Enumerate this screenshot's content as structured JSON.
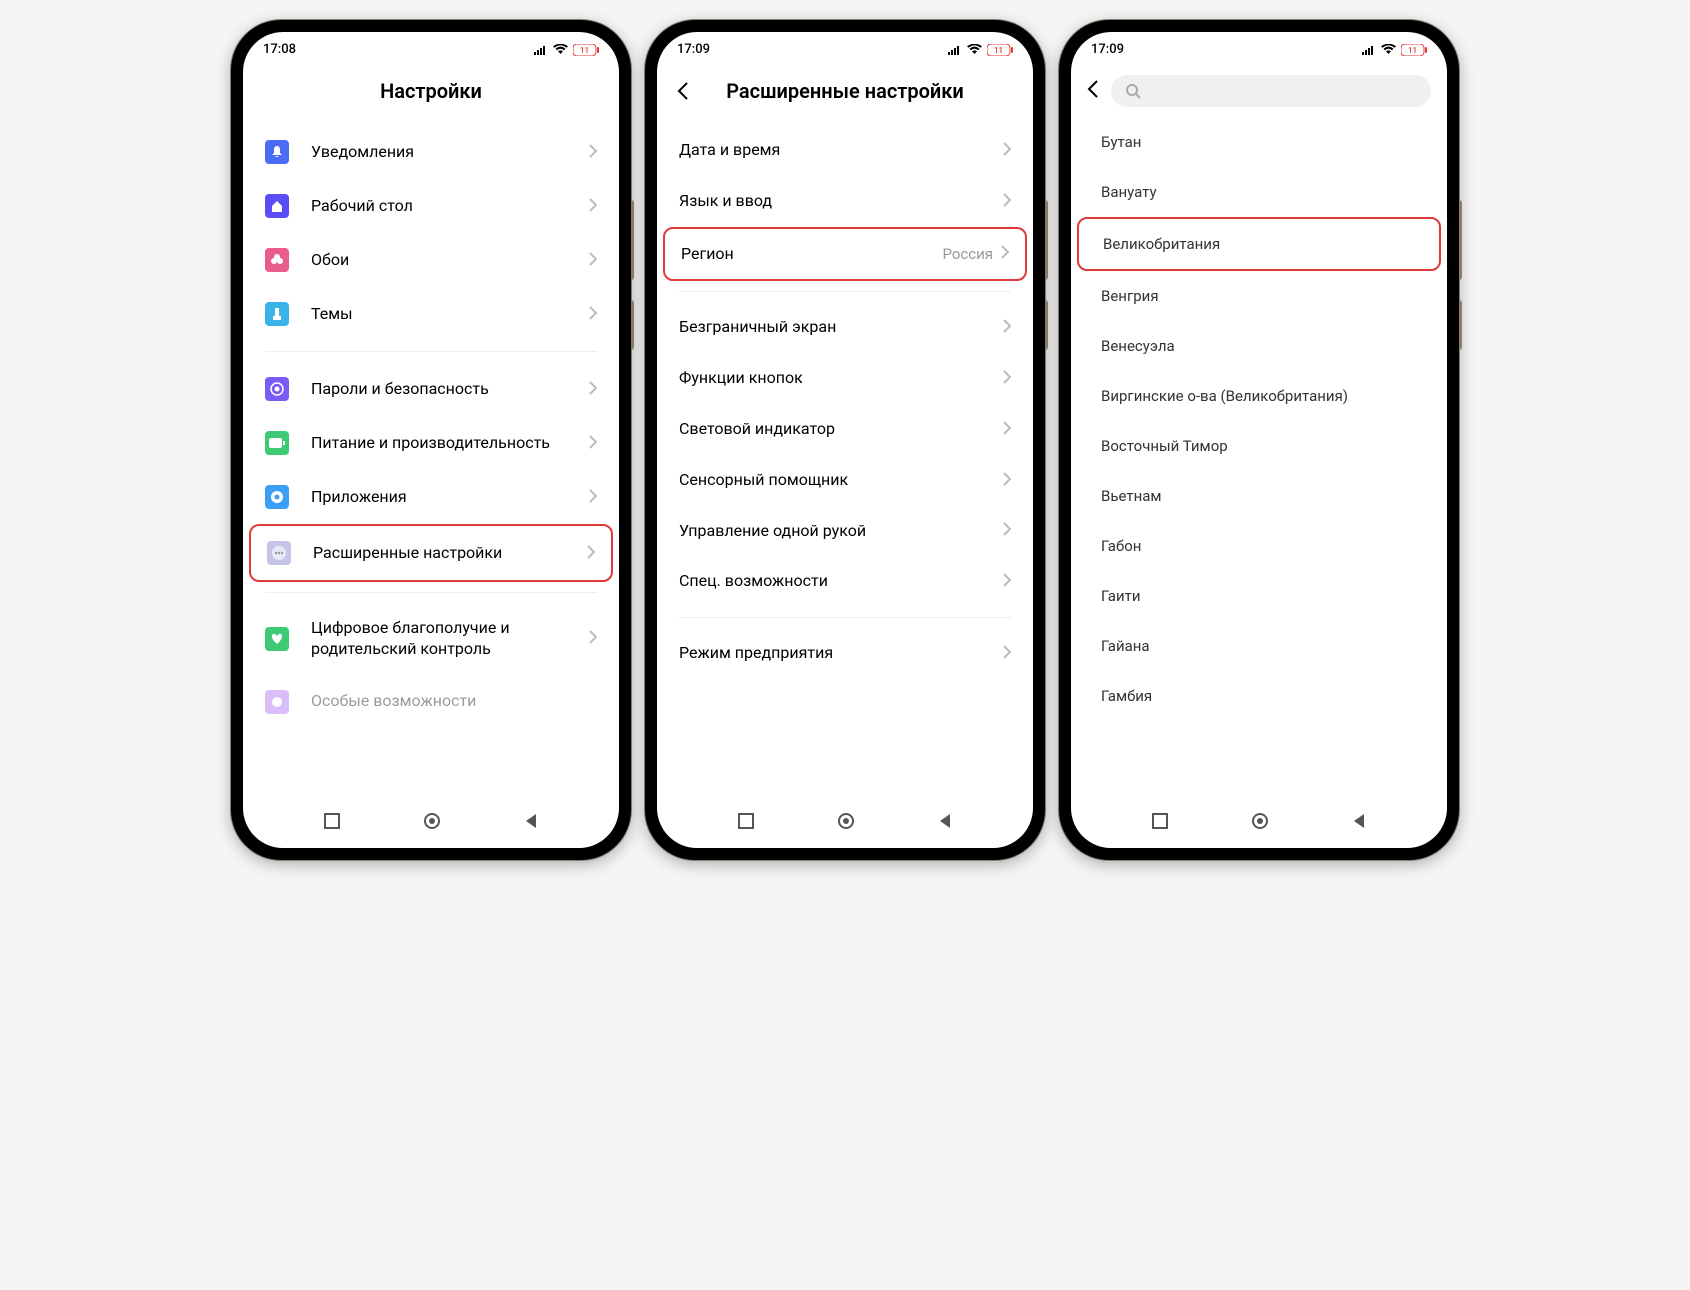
{
  "status": {
    "time1": "17:08",
    "time2": "17:09",
    "time3": "17:09",
    "battery": "11"
  },
  "screen1": {
    "title": "Настройки",
    "items": [
      {
        "label": "Уведомления",
        "icon_bg": "#4a6cf5",
        "icon": "bell"
      },
      {
        "label": "Рабочий стол",
        "icon_bg": "#5b4df5",
        "icon": "home"
      },
      {
        "label": "Обои",
        "icon_bg": "#e85d8a",
        "icon": "flower"
      },
      {
        "label": "Темы",
        "icon_bg": "#3ab4e8",
        "icon": "brush"
      }
    ],
    "items2": [
      {
        "label": "Пароли и безопасность",
        "icon_bg": "#7b5bf5",
        "icon": "shield"
      },
      {
        "label": "Питание и производительность",
        "icon_bg": "#3ec974",
        "icon": "battery"
      },
      {
        "label": "Приложения",
        "icon_bg": "#3a9ff5",
        "icon": "gear"
      },
      {
        "label": "Расширенные настройки",
        "icon_bg": "#c5c5e8",
        "icon": "dots",
        "highlight": true
      }
    ],
    "items3": [
      {
        "label": "Цифровое благополучие и родительский контроль",
        "icon_bg": "#3ec974",
        "icon": "heart"
      }
    ]
  },
  "screen2": {
    "title": "Расширенные настройки",
    "items": [
      {
        "label": "Дата и время"
      },
      {
        "label": "Язык и ввод"
      },
      {
        "label": "Регион",
        "value": "Россия",
        "highlight": true
      }
    ],
    "items2": [
      {
        "label": "Безграничный экран"
      },
      {
        "label": "Функции кнопок"
      },
      {
        "label": "Световой индикатор"
      },
      {
        "label": "Сенсорный помощник"
      },
      {
        "label": "Управление одной рукой"
      },
      {
        "label": "Спец. возможности"
      }
    ],
    "items3": [
      {
        "label": "Режим предприятия"
      }
    ]
  },
  "screen3": {
    "items": [
      "Бутан",
      "Вануату",
      "Великобритания",
      "Венгрия",
      "Венесуэла",
      "Виргинские о-ва (Великобритания)",
      "Восточный Тимор",
      "Вьетнам",
      "Габон",
      "Гаити",
      "Гайана",
      "Гамбия"
    ],
    "highlight_index": 2
  }
}
